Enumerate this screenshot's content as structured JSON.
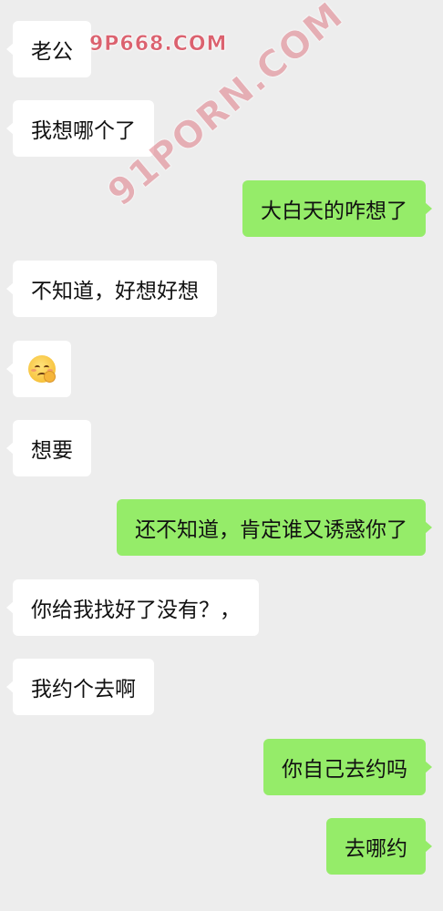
{
  "messages": [
    {
      "side": "incoming",
      "text": "老公"
    },
    {
      "side": "incoming",
      "text": "我想哪个了"
    },
    {
      "side": "outgoing",
      "text": "大白天的咋想了"
    },
    {
      "side": "incoming",
      "text": "不知道，好想好想"
    },
    {
      "side": "incoming",
      "type": "emoji",
      "emoji_name": "blushing-hand-over-mouth-emoji"
    },
    {
      "side": "incoming",
      "text": "想要"
    },
    {
      "side": "outgoing",
      "text": "还不知道，肯定谁又诱惑你了"
    },
    {
      "side": "incoming",
      "text": "你给我找好了没有？，"
    },
    {
      "side": "incoming",
      "text": "我约个去啊"
    },
    {
      "side": "outgoing",
      "text": "你自己去约吗"
    },
    {
      "side": "outgoing",
      "text": "去哪约"
    }
  ],
  "watermarks": {
    "top": "9P668.COM",
    "diagonal": "91PORN.COM"
  },
  "colors": {
    "background": "#ededed",
    "incoming_bubble": "#ffffff",
    "outgoing_bubble": "#95ec69",
    "watermark": "#d94a5a"
  }
}
